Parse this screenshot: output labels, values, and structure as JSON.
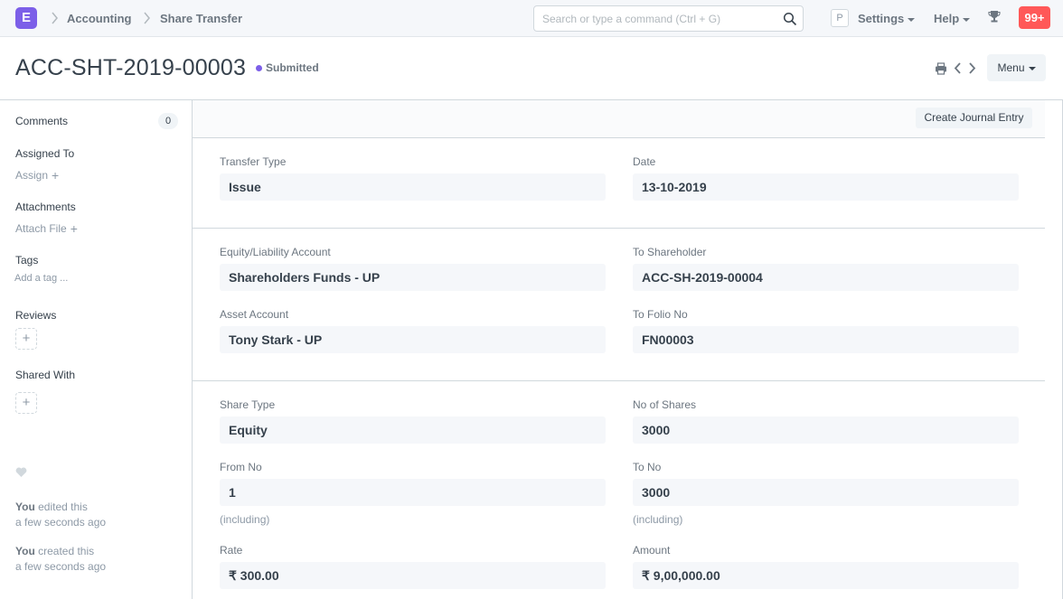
{
  "navbar": {
    "logo_letter": "E",
    "breadcrumbs": [
      "Accounting",
      "Share Transfer"
    ],
    "search_placeholder": "Search or type a command (Ctrl + G)",
    "avatar_letter": "P",
    "settings_label": "Settings",
    "help_label": "Help",
    "notification_count": "99+"
  },
  "page": {
    "title": "ACC-SHT-2019-00003",
    "status": "Submitted",
    "status_color": "#7c5fe8",
    "menu_label": "Menu"
  },
  "sidebar": {
    "comments_label": "Comments",
    "comments_count": "0",
    "assigned_to_label": "Assigned To",
    "assign_link": "Assign",
    "attachments_label": "Attachments",
    "attach_file_link": "Attach File",
    "tags_label": "Tags",
    "add_tag_link": "Add a tag ...",
    "reviews_label": "Reviews",
    "shared_with_label": "Shared With",
    "timeline": [
      {
        "user": "You",
        "action": " edited this",
        "time": "a few seconds ago"
      },
      {
        "user": "You",
        "action": " created this",
        "time": "a few seconds ago"
      }
    ]
  },
  "form": {
    "create_journal_entry_label": "Create Journal Entry",
    "fields": {
      "transfer_type": {
        "label": "Transfer Type",
        "value": "Issue"
      },
      "date": {
        "label": "Date",
        "value": "13-10-2019"
      },
      "equity_account": {
        "label": "Equity/Liability Account",
        "value": "Shareholders Funds - UP"
      },
      "to_shareholder": {
        "label": "To Shareholder",
        "value": "ACC-SH-2019-00004"
      },
      "asset_account": {
        "label": "Asset Account",
        "value": "Tony Stark - UP"
      },
      "to_folio_no": {
        "label": "To Folio No",
        "value": "FN00003"
      },
      "share_type": {
        "label": "Share Type",
        "value": "Equity"
      },
      "no_of_shares": {
        "label": "No of Shares",
        "value": "3000"
      },
      "from_no": {
        "label": "From No",
        "value": "1",
        "description": "(including)"
      },
      "to_no": {
        "label": "To No",
        "value": "3000",
        "description": "(including)"
      },
      "rate": {
        "label": "Rate",
        "value": "₹ 300.00"
      },
      "amount": {
        "label": "Amount",
        "value": "₹ 9,00,000.00"
      }
    }
  }
}
